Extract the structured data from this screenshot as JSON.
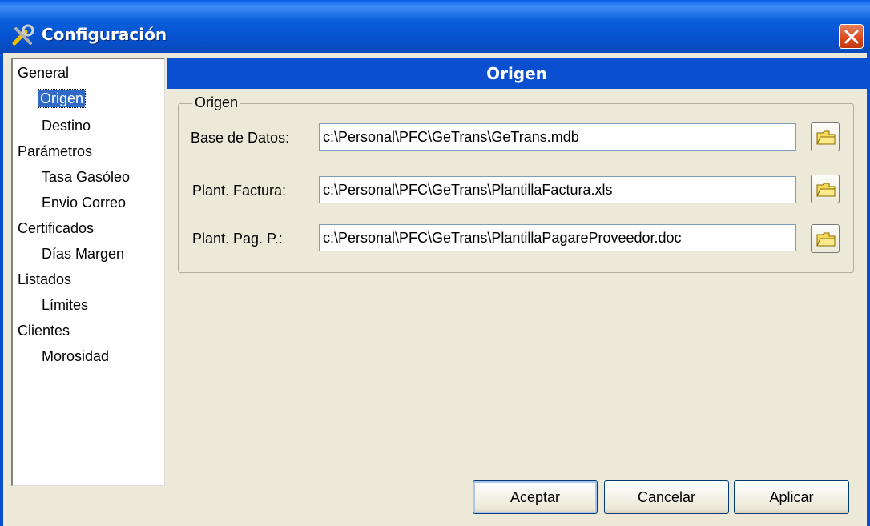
{
  "window": {
    "title": "Configuración"
  },
  "tree": {
    "items": [
      {
        "label": "General",
        "level": 0
      },
      {
        "label": "Origen",
        "level": 1,
        "selected": true
      },
      {
        "label": "Destino",
        "level": 1
      },
      {
        "label": "Parámetros",
        "level": 0
      },
      {
        "label": "Tasa Gasóleo",
        "level": 1
      },
      {
        "label": "Envio Correo",
        "level": 1
      },
      {
        "label": "Certificados",
        "level": 0
      },
      {
        "label": "Días Margen",
        "level": 1
      },
      {
        "label": "Listados",
        "level": 0
      },
      {
        "label": "Límites",
        "level": 1
      },
      {
        "label": "Clientes",
        "level": 0
      },
      {
        "label": "Morosidad",
        "level": 1
      }
    ]
  },
  "panel": {
    "title": "Origen",
    "group_label": "Origen",
    "fields": [
      {
        "label": "Base de Datos:",
        "value": "c:\\Personal\\PFC\\GeTrans\\GeTrans.mdb"
      },
      {
        "label": "Plant. Factura:",
        "value": "c:\\Personal\\PFC\\GeTrans\\PlantillaFactura.xls"
      },
      {
        "label": "Plant. Pag. P.:",
        "value": "c:\\Personal\\PFC\\GeTrans\\PlantillaPagareProveedor.doc"
      }
    ]
  },
  "buttons": {
    "accept": "Aceptar",
    "cancel": "Cancelar",
    "apply": "Aplicar"
  },
  "colors": {
    "title_bar": "#0a5ed9",
    "header_band": "#0a4fd0",
    "selection": "#316ac5",
    "dialog_bg": "#ece9d8"
  }
}
